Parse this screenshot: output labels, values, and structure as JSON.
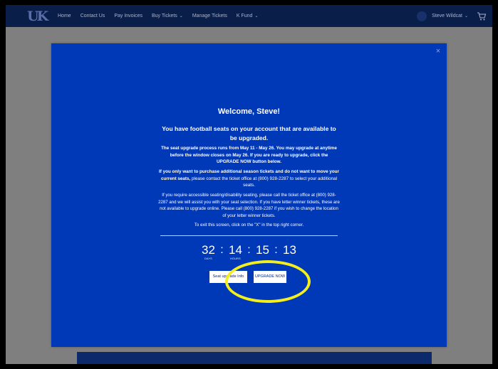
{
  "navbar": {
    "logo_text": "UK",
    "links": [
      {
        "label": "Home"
      },
      {
        "label": "Contact Us"
      },
      {
        "label": "Pay Invoices"
      },
      {
        "label": "Buy Tickets",
        "has_dropdown": true
      },
      {
        "label": "Manage Tickets"
      },
      {
        "label": "K Fund",
        "has_dropdown": true
      }
    ],
    "user_name": "Steve Wildcat",
    "cart_icon": "cart-icon",
    "background_color": "#0a1e4a"
  },
  "modal": {
    "background_color": "#0039b8",
    "close_label": "×",
    "welcome": "Welcome, Steve!",
    "subtitle": "You have football seats on your account that are available to be upgraded.",
    "para1": "The seat upgrade process runs from May 11 - May 26. You may upgrade at anytime before the window closes on May 26. If you are ready to upgrade, click the UPGRADE NOW button below.",
    "para2_bold": "If you only want to purchase additional season tickets and do not want to move your current seats,",
    "para2_rest": " please contact the ticket office at (800) 928-2287 to select your additional seats.",
    "para3": "If you require accessible seating/disability seating, please call the ticket office at (800) 928-2287 and we will assist you with your seat selection. If you have letter winner tickets, these are not available to upgrade online. Please call (800) 928-2287 if you wish to change the location of your letter winner tickets.",
    "para4": "To exit this screen, click on the \"X\" in the top right corner.",
    "countdown": {
      "days": "32",
      "days_label": "DAYS",
      "hours": "14",
      "hours_label": "HOURS",
      "minutes": "15",
      "seconds": "13",
      "separator": ":"
    },
    "seat_upgrade_info_label": "Seat upgrade Info",
    "upgrade_now_label": "UPGRADE NOW"
  },
  "annotation": {
    "highlight_color": "#f4ef1c"
  }
}
